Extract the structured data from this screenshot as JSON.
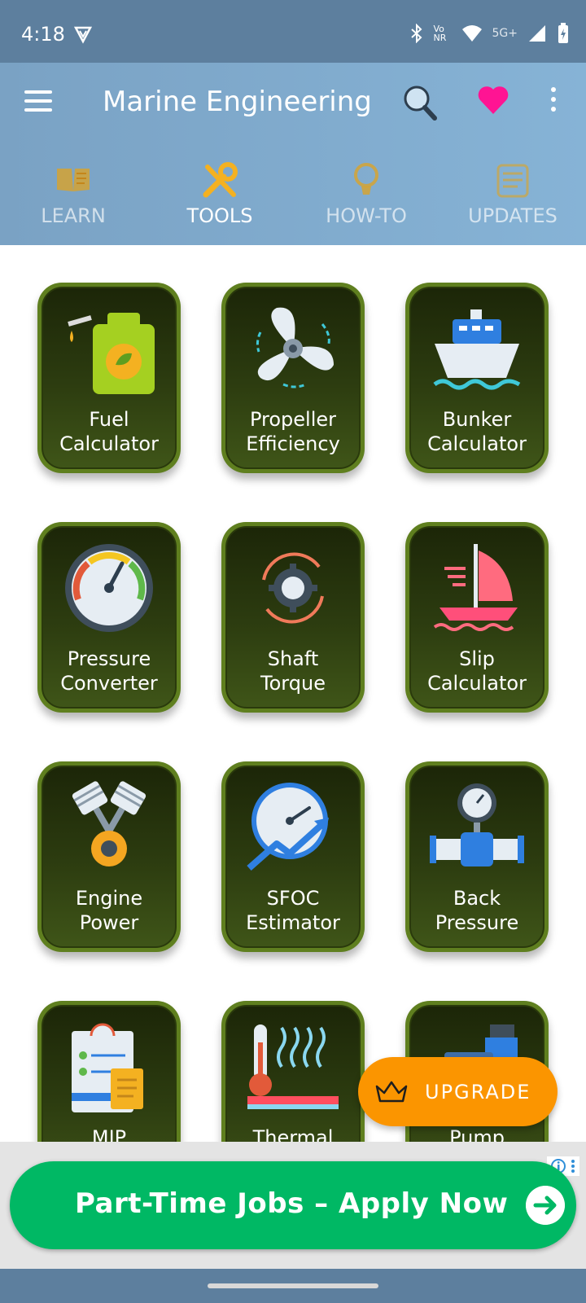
{
  "status_bar": {
    "time": "4:18",
    "network_label": "5G+",
    "volte_label": "Vo NR"
  },
  "header": {
    "title": "Marine Engineering"
  },
  "tabs": [
    {
      "label": "LEARN",
      "icon": "book-icon",
      "active": false
    },
    {
      "label": "TOOLS",
      "icon": "tools-icon",
      "active": true
    },
    {
      "label": "HOW-TO",
      "icon": "bulb-icon",
      "active": false
    },
    {
      "label": "UPDATES",
      "icon": "news-icon",
      "active": false
    }
  ],
  "tools": [
    {
      "label_line1": "Fuel",
      "label_line2": "Calculator",
      "icon": "fuel-can-icon"
    },
    {
      "label_line1": "Propeller",
      "label_line2": "Efficiency",
      "icon": "propeller-icon"
    },
    {
      "label_line1": "Bunker",
      "label_line2": "Calculator",
      "icon": "ship-icon"
    },
    {
      "label_line1": "Pressure",
      "label_line2": "Converter",
      "icon": "gauge-icon"
    },
    {
      "label_line1": "Shaft",
      "label_line2": "Torque",
      "icon": "gear-rotate-icon"
    },
    {
      "label_line1": "Slip",
      "label_line2": "Calculator",
      "icon": "sailboat-icon"
    },
    {
      "label_line1": "Engine",
      "label_line2": "Power",
      "icon": "pistons-icon"
    },
    {
      "label_line1": "SFOC",
      "label_line2": "Estimator",
      "icon": "speedometer-icon"
    },
    {
      "label_line1": "Back",
      "label_line2": "Pressure",
      "icon": "pipe-gauge-icon"
    },
    {
      "label_line1": "MIP",
      "label_line2": "",
      "icon": "checklist-icon"
    },
    {
      "label_line1": "Thermal",
      "label_line2": "",
      "icon": "thermometer-icon"
    },
    {
      "label_line1": "Pump",
      "label_line2": "",
      "icon": "pump-icon"
    }
  ],
  "upgrade": {
    "label": "UPGRADE"
  },
  "ad": {
    "text": "Part-Time Jobs – Apply Now"
  },
  "colors": {
    "status_bar": "#5d7f9e",
    "header": "#7aa2c4",
    "tab_icon": "#e0a31f",
    "card_border": "#5f7f1f",
    "upgrade": "#fb9500",
    "ad_green": "#00b864",
    "favorite": "#ff1493"
  }
}
